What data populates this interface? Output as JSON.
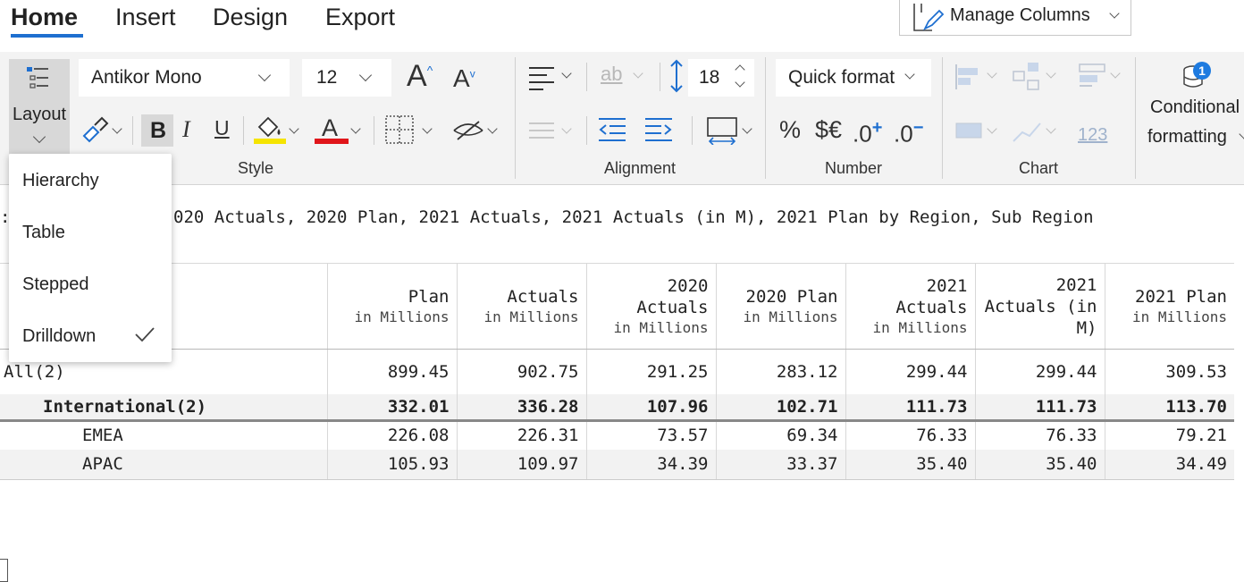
{
  "tabs": [
    "Home",
    "Insert",
    "Design",
    "Export"
  ],
  "manage_columns": "Manage Columns",
  "layout_button": "Layout",
  "font": {
    "family": "Antikor Mono",
    "size": "12"
  },
  "row_height": "18",
  "quick_format": "Quick format",
  "number_icons": {
    "percent": "%",
    "currency": "$€",
    "inc_decimal": ".0",
    "dec_decimal": ".0"
  },
  "chart_icon_label": "123",
  "conditional_formatting": {
    "line1": "Conditional",
    "line2": "formatting"
  },
  "group_labels": {
    "style": "Style",
    "alignment": "Alignment",
    "number": "Number",
    "chart": "Chart"
  },
  "layout_menu": {
    "items": [
      "Hierarchy",
      "Table",
      "Stepped",
      "Drilldown"
    ],
    "checked": "Drilldown"
  },
  "fields_line": "020 Actuals, 2020 Plan, 2021 Actuals, 2021 Actuals (in M), 2021 Plan by Region, Sub Region",
  "table": {
    "columns": [
      {
        "main": "Plan",
        "unit": "in Millions"
      },
      {
        "main": "Actuals",
        "unit": "in Millions"
      },
      {
        "main": "2020\nActuals",
        "unit": "in Millions"
      },
      {
        "main": "2020 Plan",
        "unit": "in Millions"
      },
      {
        "main": "2021\nActuals",
        "unit": "in Millions"
      },
      {
        "main": "2021\nActuals (in\nM)",
        "unit": ""
      },
      {
        "main": "2021 Plan",
        "unit": "in Millions"
      }
    ],
    "rows": [
      {
        "label": "All(2)",
        "values": [
          "899.45",
          "902.75",
          "291.25",
          "283.12",
          "299.44",
          "299.44",
          "309.53"
        ]
      },
      {
        "label": "International(2)",
        "values": [
          "332.01",
          "336.28",
          "107.96",
          "102.71",
          "111.73",
          "111.73",
          "113.70"
        ]
      },
      {
        "label": "EMEA",
        "values": [
          "226.08",
          "226.31",
          "73.57",
          "69.34",
          "76.33",
          "76.33",
          "79.21"
        ]
      },
      {
        "label": "APAC",
        "values": [
          "105.93",
          "109.97",
          "34.39",
          "33.37",
          "35.40",
          "35.40",
          "34.49"
        ]
      }
    ]
  },
  "colors": {
    "accent": "#1e6fd0",
    "badge": "#1e7be0",
    "highlight_yellow": "#f5e400",
    "font_red": "#e0151a"
  }
}
